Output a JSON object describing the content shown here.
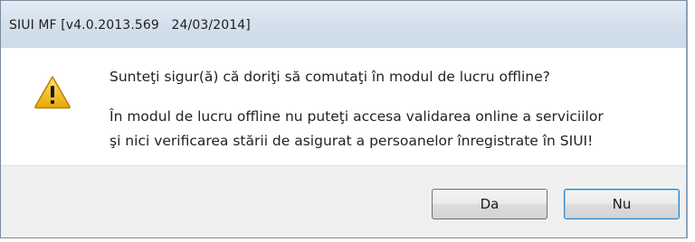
{
  "window": {
    "title": "SIUI MF [v4.0.2013.569   24/03/2014]"
  },
  "dialog": {
    "icon": "warning-icon",
    "main_instruction": "Sunteţi sigur(ă) că doriţi să comutaţi în modul de lucru offline?",
    "detail_lines": [
      "În modul de lucru offline nu puteţi accesa validarea online a serviciilor",
      "şi nici verificarea stării de asigurat a persoanelor înregistrate în SIUI!"
    ]
  },
  "buttons": {
    "yes_label": "Da",
    "no_label": "Nu"
  },
  "colors": {
    "warning_fill": "#f2c31f",
    "titlebar": "#d3dfeb",
    "footer": "#f0f0f0",
    "default_button_border": "#3c7fb1"
  }
}
